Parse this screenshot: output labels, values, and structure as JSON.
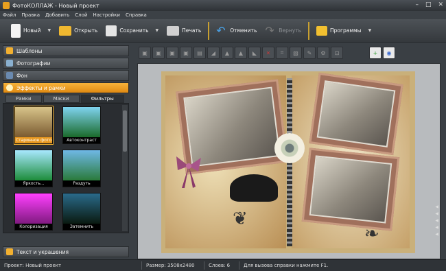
{
  "window": {
    "title": "ФотоКОЛЛАЖ - Новый проект",
    "controls": [
      "–",
      "□",
      "✕"
    ]
  },
  "menu": [
    "Файл",
    "Правка",
    "Добавить",
    "Слой",
    "Настройки",
    "Справка"
  ],
  "toolbar": {
    "new_label": "Новый",
    "open_label": "Открыть",
    "save_label": "Сохранить",
    "print_label": "Печать",
    "undo_label": "Отменить",
    "redo_label": "Вернуть",
    "programs_label": "Программы"
  },
  "sidebar": {
    "templates": "Шаблоны",
    "photos": "Фотографии",
    "background": "Фон",
    "effects": "Эффекты и рамки",
    "text": "Текст и украшения",
    "tabs": [
      "Рамки",
      "Маски",
      "Фильтры"
    ],
    "active_tab": "Фильтры",
    "filters": [
      {
        "label": "Старинное фото",
        "selected": true,
        "colors": [
          "#d8c48a",
          "#7a5a30"
        ]
      },
      {
        "label": "Автоконтраст",
        "selected": false,
        "colors": [
          "#7fd3f0",
          "#1a6a2a"
        ]
      },
      {
        "label": "Яркость...",
        "selected": false,
        "colors": [
          "#a8e8ff",
          "#1d8c3a"
        ]
      },
      {
        "label": "Раздуть",
        "selected": false,
        "colors": [
          "#6fb8e6",
          "#2a7a3a"
        ]
      },
      {
        "label": "Колоризация",
        "selected": false,
        "colors": [
          "#ff40ff",
          "#801a80"
        ]
      },
      {
        "label": "Затемнить",
        "selected": false,
        "colors": [
          "#2a6a8a",
          "#0a1a10"
        ]
      }
    ]
  },
  "status": {
    "project": "Проект: Новый проект",
    "size": "Размер: 3508x2480",
    "layers": "Слоев: 6",
    "help": "Для вызова справки нажмите F1."
  },
  "colors": {
    "accent": "#f2a81e",
    "selected_tab": "#e89820"
  }
}
